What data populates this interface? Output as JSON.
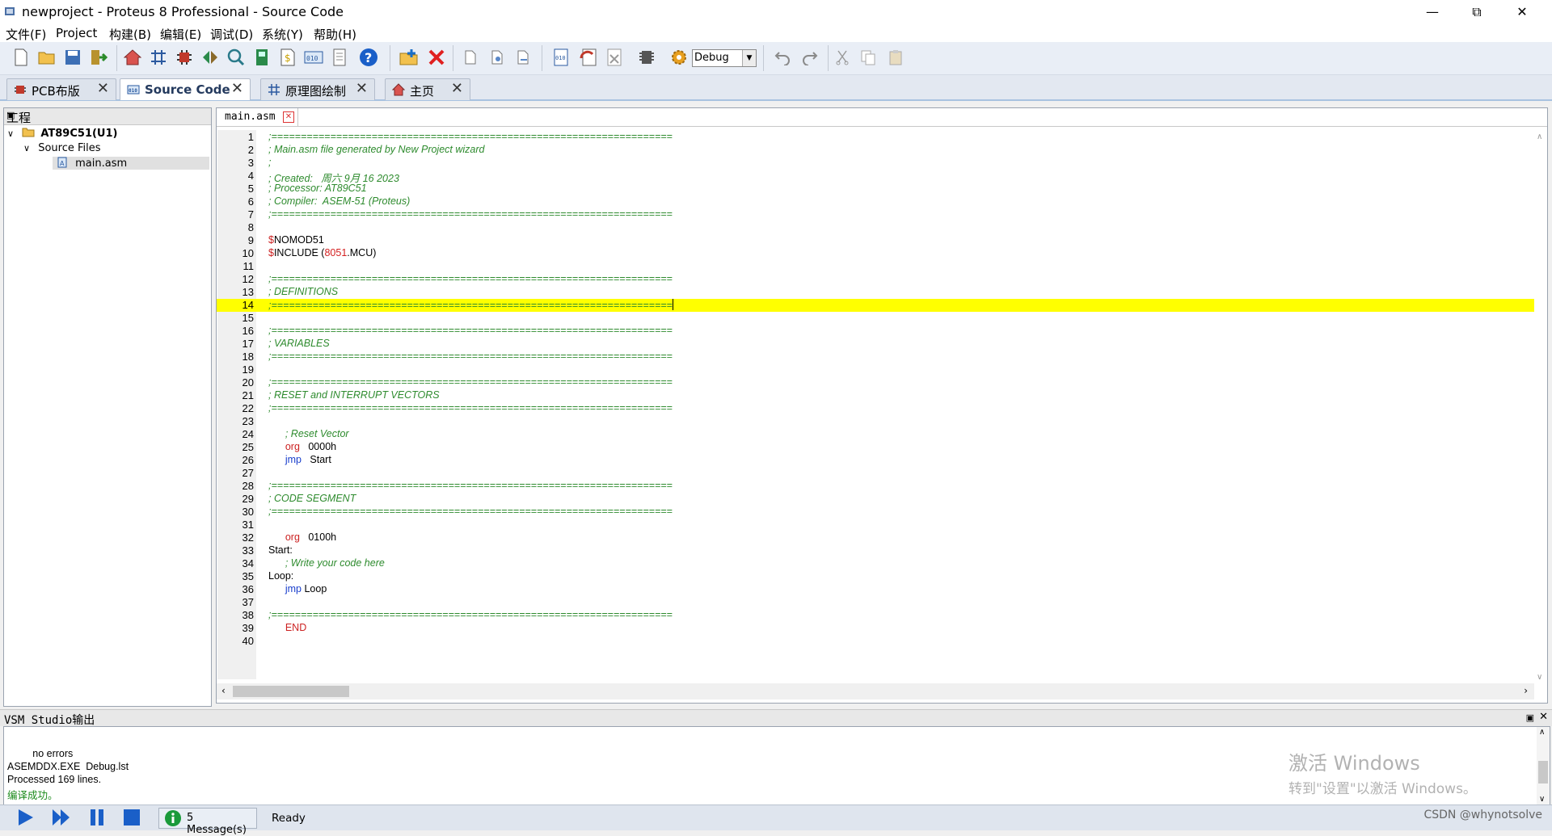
{
  "window": {
    "title": "newproject - Proteus 8 Professional - Source Code"
  },
  "menu": [
    "文件(F)",
    "Project",
    "构建(B)",
    "编辑(E)",
    "调试(D)",
    "系统(Y)",
    "帮助(H)"
  ],
  "toolbar": {
    "build_config": "Debug"
  },
  "tabs": [
    {
      "label": "PCB布版",
      "icon": "pcb-icon",
      "active": false
    },
    {
      "label": "Source Code",
      "icon": "source-code-icon",
      "active": true
    },
    {
      "label": "原理图绘制",
      "icon": "schematic-icon",
      "active": false
    },
    {
      "label": "主页",
      "icon": "home-icon",
      "active": false
    }
  ],
  "project_panel": {
    "title": "工程",
    "root": "AT89C51(U1)",
    "folder": "Source Files",
    "file": "main.asm"
  },
  "editor": {
    "doc_tab": "main.asm",
    "lines": [
      {
        "n": "1",
        "segs": [
          [
            "cm",
            ";===================================================================="
          ]
        ]
      },
      {
        "n": "2",
        "segs": [
          [
            "cm",
            "; Main.asm file generated by New Project wizard"
          ]
        ]
      },
      {
        "n": "3",
        "segs": [
          [
            "cm",
            ";"
          ]
        ]
      },
      {
        "n": "4",
        "segs": [
          [
            "cm",
            "; Created:   周六 9月 16 2023"
          ]
        ]
      },
      {
        "n": "5",
        "segs": [
          [
            "cm",
            "; Processor: AT89C51"
          ]
        ]
      },
      {
        "n": "6",
        "segs": [
          [
            "cm",
            "; Compiler:  ASEM-51 (Proteus)"
          ]
        ]
      },
      {
        "n": "7",
        "segs": [
          [
            "cm",
            ";===================================================================="
          ]
        ]
      },
      {
        "n": "8",
        "segs": []
      },
      {
        "n": "9",
        "segs": [
          [
            "kw",
            "$"
          ],
          [
            "tx",
            "NOMOD51"
          ]
        ]
      },
      {
        "n": "10",
        "segs": [
          [
            "kw",
            "$"
          ],
          [
            "tx",
            "INCLUDE ("
          ],
          [
            "nm",
            "8051"
          ],
          [
            "tx",
            ".MCU)"
          ]
        ]
      },
      {
        "n": "11",
        "segs": []
      },
      {
        "n": "12",
        "segs": [
          [
            "cm",
            ";===================================================================="
          ]
        ]
      },
      {
        "n": "13",
        "segs": [
          [
            "cm",
            "; DEFINITIONS"
          ]
        ]
      },
      {
        "n": "14",
        "segs": [
          [
            "cm",
            ";===================================================================="
          ]
        ],
        "highlight": true
      },
      {
        "n": "15",
        "segs": []
      },
      {
        "n": "16",
        "segs": [
          [
            "cm",
            ";===================================================================="
          ]
        ]
      },
      {
        "n": "17",
        "segs": [
          [
            "cm",
            "; VARIABLES"
          ]
        ]
      },
      {
        "n": "18",
        "segs": [
          [
            "cm",
            ";===================================================================="
          ]
        ]
      },
      {
        "n": "19",
        "segs": []
      },
      {
        "n": "20",
        "segs": [
          [
            "cm",
            ";===================================================================="
          ]
        ]
      },
      {
        "n": "21",
        "segs": [
          [
            "cm",
            "; RESET and INTERRUPT VECTORS"
          ]
        ]
      },
      {
        "n": "22",
        "segs": [
          [
            "cm",
            ";===================================================================="
          ]
        ]
      },
      {
        "n": "23",
        "segs": []
      },
      {
        "n": "24",
        "segs": [
          [
            "tx",
            "      "
          ],
          [
            "cm",
            "; Reset Vector"
          ]
        ]
      },
      {
        "n": "25",
        "segs": [
          [
            "tx",
            "      "
          ],
          [
            "kw",
            "org"
          ],
          [
            "tx",
            "   0000h"
          ]
        ]
      },
      {
        "n": "26",
        "segs": [
          [
            "tx",
            "      "
          ],
          [
            "jp",
            "jmp"
          ],
          [
            "tx",
            "   Start"
          ]
        ]
      },
      {
        "n": "27",
        "segs": []
      },
      {
        "n": "28",
        "segs": [
          [
            "cm",
            ";===================================================================="
          ]
        ]
      },
      {
        "n": "29",
        "segs": [
          [
            "cm",
            "; CODE SEGMENT"
          ]
        ]
      },
      {
        "n": "30",
        "segs": [
          [
            "cm",
            ";===================================================================="
          ]
        ]
      },
      {
        "n": "31",
        "segs": []
      },
      {
        "n": "32",
        "segs": [
          [
            "tx",
            "      "
          ],
          [
            "kw",
            "org"
          ],
          [
            "tx",
            "   0100h"
          ]
        ]
      },
      {
        "n": "33",
        "segs": [
          [
            "tx",
            "Start:"
          ]
        ]
      },
      {
        "n": "34",
        "segs": [
          [
            "tx",
            "      "
          ],
          [
            "cm",
            "; Write your code here"
          ]
        ]
      },
      {
        "n": "35",
        "segs": [
          [
            "tx",
            "Loop:"
          ]
        ]
      },
      {
        "n": "36",
        "segs": [
          [
            "tx",
            "      "
          ],
          [
            "jp",
            "jmp"
          ],
          [
            "tx",
            " Loop"
          ]
        ]
      },
      {
        "n": "37",
        "segs": []
      },
      {
        "n": "38",
        "segs": [
          [
            "cm",
            ";===================================================================="
          ]
        ]
      },
      {
        "n": "39",
        "segs": [
          [
            "tx",
            "      "
          ],
          [
            "kw",
            "END"
          ]
        ]
      },
      {
        "n": "40",
        "segs": []
      }
    ]
  },
  "output_panel": {
    "title": "VSM Studio输出",
    "lines": [
      {
        "text": "         no errors",
        "color": "#000000"
      },
      {
        "text": "ASEMDDX.EXE  Debug.lst",
        "color": "#000000"
      },
      {
        "text": "Processed 169 lines.",
        "color": "#000000"
      },
      {
        "text": "编译成功。",
        "color": "#1a8a1a"
      }
    ],
    "watermark_line1": "激活 Windows",
    "watermark_line2": "转到\"设置\"以激活 Windows。"
  },
  "statusbar": {
    "messages": "5 Message(s)",
    "status": "Ready",
    "credit": "CSDN @whynotsolve"
  },
  "colors": {
    "highlight": "#ffff00",
    "comment": "#2e8b2e",
    "keyword": "#cc2222",
    "jump": "#1a3fcc"
  }
}
